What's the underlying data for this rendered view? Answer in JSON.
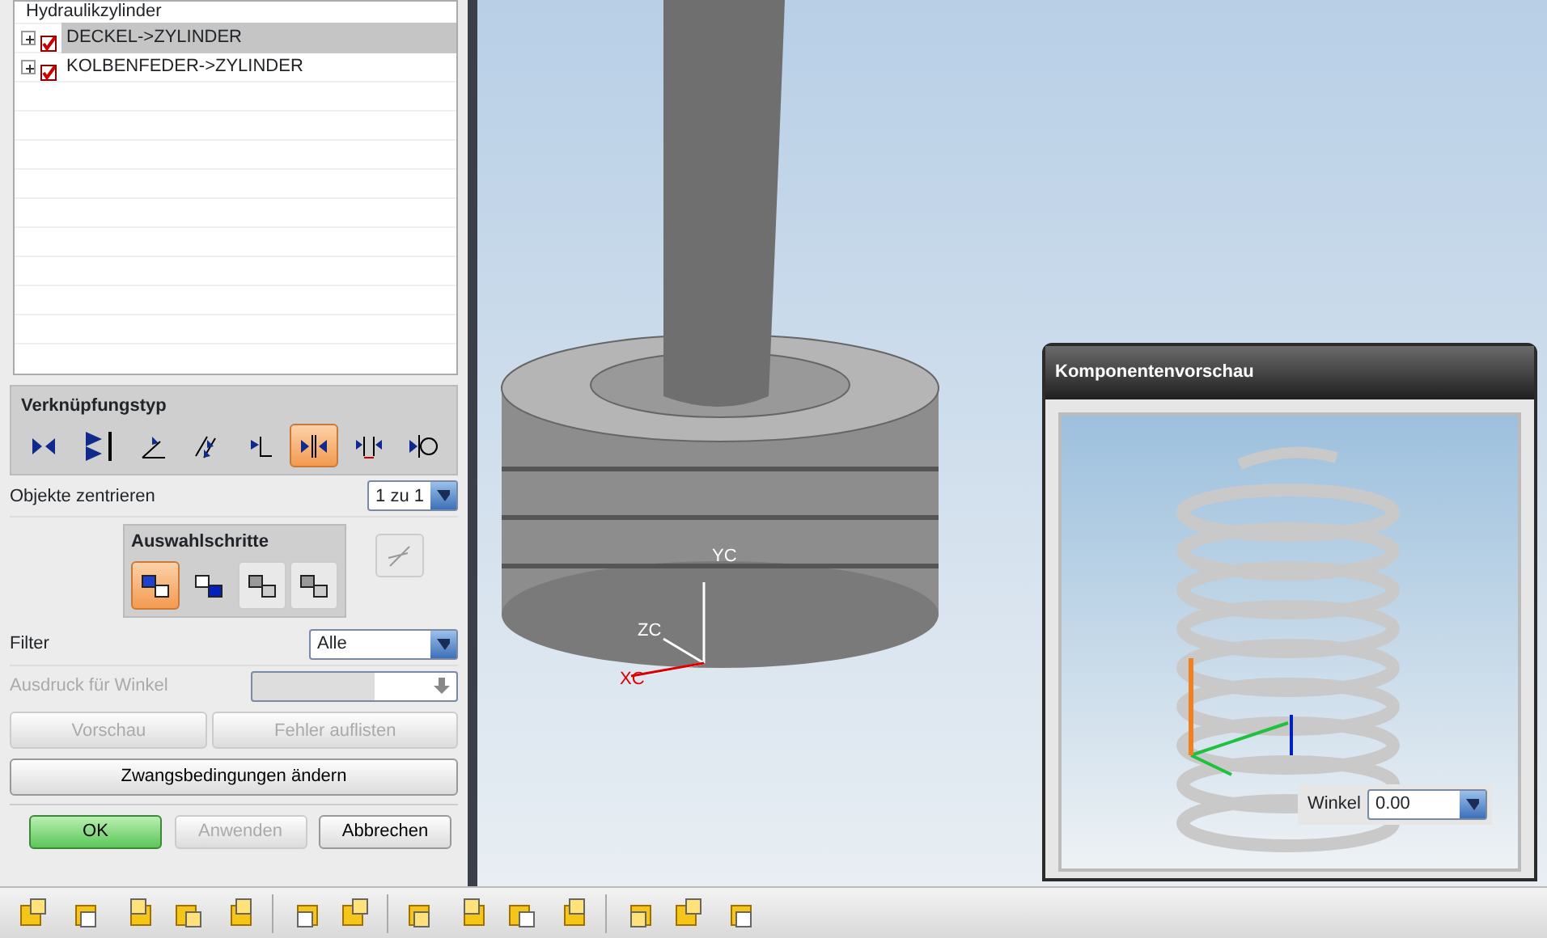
{
  "tree": {
    "root": "Hydraulikzylinder",
    "items": [
      {
        "label": "DECKEL->ZYLINDER",
        "checked": true,
        "selected": true
      },
      {
        "label": "KOLBENFEDER->ZYLINDER",
        "checked": true,
        "selected": false
      }
    ]
  },
  "link_type": {
    "title": "Verknüpfungstyp",
    "types": [
      {
        "selected": false
      },
      {
        "selected": false
      },
      {
        "selected": false
      },
      {
        "selected": false
      },
      {
        "selected": false
      },
      {
        "selected": true
      },
      {
        "selected": false
      },
      {
        "selected": false
      }
    ]
  },
  "center": {
    "label": "Objekte zentrieren",
    "value": "1 zu 1"
  },
  "steps": {
    "title": "Auswahlschritte",
    "buttons": [
      {
        "selected": true,
        "disabled": false
      },
      {
        "selected": false,
        "disabled": false
      },
      {
        "selected": false,
        "disabled": true
      },
      {
        "selected": false,
        "disabled": true
      }
    ]
  },
  "filter": {
    "label": "Filter",
    "value": "Alle"
  },
  "angle_expr": {
    "label": "Ausdruck für Winkel",
    "disabled": true
  },
  "buttons_row": [
    {
      "label": "Vorschau",
      "disabled": true
    },
    {
      "label": "Fehler auflisten",
      "disabled": true
    }
  ],
  "change_button": {
    "label": "Zwangsbedingungen ändern"
  },
  "dialog_buttons": [
    {
      "label": "OK",
      "kind": "primary",
      "disabled": false
    },
    {
      "label": "Anwenden",
      "kind": "normal",
      "disabled": true
    },
    {
      "label": "Abbrechen",
      "kind": "normal",
      "disabled": false
    }
  ],
  "viewport": {
    "axes": [
      "YC",
      "ZC",
      "XC"
    ]
  },
  "preview": {
    "title": "Komponentenvorschau",
    "angle_label": "Winkel",
    "angle_value": "0.00"
  }
}
